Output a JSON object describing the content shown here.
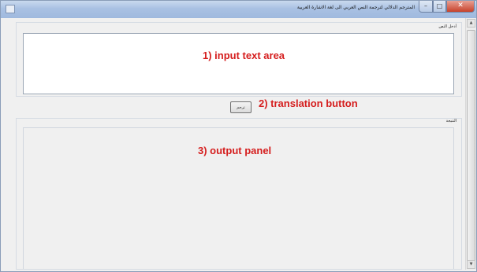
{
  "window": {
    "title": "المترجم الدلالي لترجمة النص العربي الى لغة الاشارة العربية",
    "controls": {
      "minimize": "–",
      "maximize": "□",
      "close": "✕"
    }
  },
  "input_section": {
    "label": "أدخل النص",
    "text": ""
  },
  "translate_button": {
    "label": "ترجم"
  },
  "output_section": {
    "label": "النتيجة"
  },
  "scrollbar": {
    "up_icon": "▲",
    "down_icon": "▼"
  },
  "annotations": {
    "input": "1) input text area",
    "button": "2) translation button",
    "output": "3) output panel"
  }
}
